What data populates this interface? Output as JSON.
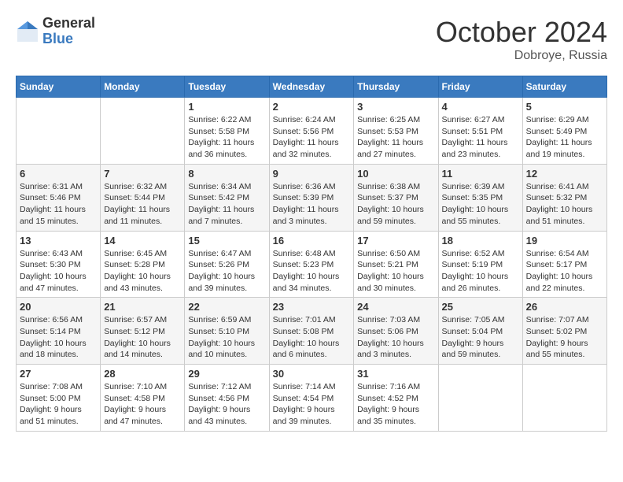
{
  "logo": {
    "general": "General",
    "blue": "Blue"
  },
  "title": "October 2024",
  "location": "Dobroye, Russia",
  "days_of_week": [
    "Sunday",
    "Monday",
    "Tuesday",
    "Wednesday",
    "Thursday",
    "Friday",
    "Saturday"
  ],
  "weeks": [
    [
      {
        "day": "",
        "info": ""
      },
      {
        "day": "",
        "info": ""
      },
      {
        "day": "1",
        "info": "Sunrise: 6:22 AM\nSunset: 5:58 PM\nDaylight: 11 hours and 36 minutes."
      },
      {
        "day": "2",
        "info": "Sunrise: 6:24 AM\nSunset: 5:56 PM\nDaylight: 11 hours and 32 minutes."
      },
      {
        "day": "3",
        "info": "Sunrise: 6:25 AM\nSunset: 5:53 PM\nDaylight: 11 hours and 27 minutes."
      },
      {
        "day": "4",
        "info": "Sunrise: 6:27 AM\nSunset: 5:51 PM\nDaylight: 11 hours and 23 minutes."
      },
      {
        "day": "5",
        "info": "Sunrise: 6:29 AM\nSunset: 5:49 PM\nDaylight: 11 hours and 19 minutes."
      }
    ],
    [
      {
        "day": "6",
        "info": "Sunrise: 6:31 AM\nSunset: 5:46 PM\nDaylight: 11 hours and 15 minutes."
      },
      {
        "day": "7",
        "info": "Sunrise: 6:32 AM\nSunset: 5:44 PM\nDaylight: 11 hours and 11 minutes."
      },
      {
        "day": "8",
        "info": "Sunrise: 6:34 AM\nSunset: 5:42 PM\nDaylight: 11 hours and 7 minutes."
      },
      {
        "day": "9",
        "info": "Sunrise: 6:36 AM\nSunset: 5:39 PM\nDaylight: 11 hours and 3 minutes."
      },
      {
        "day": "10",
        "info": "Sunrise: 6:38 AM\nSunset: 5:37 PM\nDaylight: 10 hours and 59 minutes."
      },
      {
        "day": "11",
        "info": "Sunrise: 6:39 AM\nSunset: 5:35 PM\nDaylight: 10 hours and 55 minutes."
      },
      {
        "day": "12",
        "info": "Sunrise: 6:41 AM\nSunset: 5:32 PM\nDaylight: 10 hours and 51 minutes."
      }
    ],
    [
      {
        "day": "13",
        "info": "Sunrise: 6:43 AM\nSunset: 5:30 PM\nDaylight: 10 hours and 47 minutes."
      },
      {
        "day": "14",
        "info": "Sunrise: 6:45 AM\nSunset: 5:28 PM\nDaylight: 10 hours and 43 minutes."
      },
      {
        "day": "15",
        "info": "Sunrise: 6:47 AM\nSunset: 5:26 PM\nDaylight: 10 hours and 39 minutes."
      },
      {
        "day": "16",
        "info": "Sunrise: 6:48 AM\nSunset: 5:23 PM\nDaylight: 10 hours and 34 minutes."
      },
      {
        "day": "17",
        "info": "Sunrise: 6:50 AM\nSunset: 5:21 PM\nDaylight: 10 hours and 30 minutes."
      },
      {
        "day": "18",
        "info": "Sunrise: 6:52 AM\nSunset: 5:19 PM\nDaylight: 10 hours and 26 minutes."
      },
      {
        "day": "19",
        "info": "Sunrise: 6:54 AM\nSunset: 5:17 PM\nDaylight: 10 hours and 22 minutes."
      }
    ],
    [
      {
        "day": "20",
        "info": "Sunrise: 6:56 AM\nSunset: 5:14 PM\nDaylight: 10 hours and 18 minutes."
      },
      {
        "day": "21",
        "info": "Sunrise: 6:57 AM\nSunset: 5:12 PM\nDaylight: 10 hours and 14 minutes."
      },
      {
        "day": "22",
        "info": "Sunrise: 6:59 AM\nSunset: 5:10 PM\nDaylight: 10 hours and 10 minutes."
      },
      {
        "day": "23",
        "info": "Sunrise: 7:01 AM\nSunset: 5:08 PM\nDaylight: 10 hours and 6 minutes."
      },
      {
        "day": "24",
        "info": "Sunrise: 7:03 AM\nSunset: 5:06 PM\nDaylight: 10 hours and 3 minutes."
      },
      {
        "day": "25",
        "info": "Sunrise: 7:05 AM\nSunset: 5:04 PM\nDaylight: 9 hours and 59 minutes."
      },
      {
        "day": "26",
        "info": "Sunrise: 7:07 AM\nSunset: 5:02 PM\nDaylight: 9 hours and 55 minutes."
      }
    ],
    [
      {
        "day": "27",
        "info": "Sunrise: 7:08 AM\nSunset: 5:00 PM\nDaylight: 9 hours and 51 minutes."
      },
      {
        "day": "28",
        "info": "Sunrise: 7:10 AM\nSunset: 4:58 PM\nDaylight: 9 hours and 47 minutes."
      },
      {
        "day": "29",
        "info": "Sunrise: 7:12 AM\nSunset: 4:56 PM\nDaylight: 9 hours and 43 minutes."
      },
      {
        "day": "30",
        "info": "Sunrise: 7:14 AM\nSunset: 4:54 PM\nDaylight: 9 hours and 39 minutes."
      },
      {
        "day": "31",
        "info": "Sunrise: 7:16 AM\nSunset: 4:52 PM\nDaylight: 9 hours and 35 minutes."
      },
      {
        "day": "",
        "info": ""
      },
      {
        "day": "",
        "info": ""
      }
    ]
  ]
}
